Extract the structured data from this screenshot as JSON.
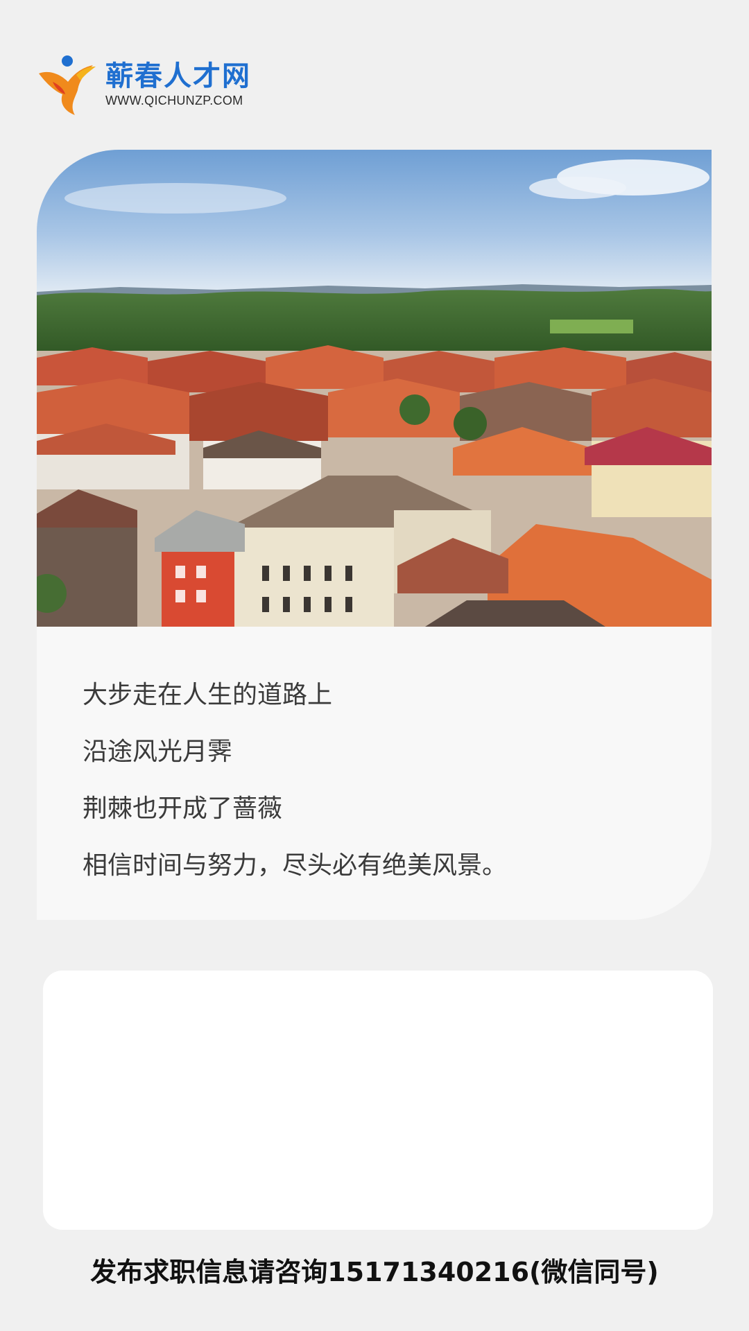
{
  "logo": {
    "icon": "running-person-logo-icon",
    "name": "蕲春人才网",
    "url": "WWW.QICHUNZP.COM",
    "colors": {
      "brand_blue": "#1f6fd0",
      "orange": "#f08a1c",
      "red": "#e0401f",
      "yellow": "#f5b31c"
    }
  },
  "card": {
    "photo": "town-rooftops-photo",
    "quote_lines": [
      "大步走在人生的道路上",
      "沿途风光月霁",
      "荆棘也开成了蔷薇",
      "相信时间与努力，尽头必有绝美风景。"
    ]
  },
  "footer": {
    "text": "发布求职信息请咨询15171340216(微信同号)"
  }
}
